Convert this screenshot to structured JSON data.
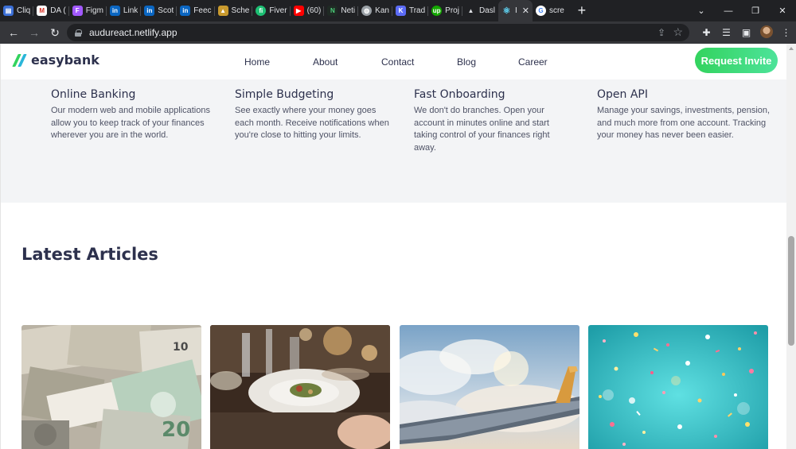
{
  "browser": {
    "tabs": [
      {
        "title": "Cliq",
        "icon": "chat-icon",
        "color": "#3b6fd6"
      },
      {
        "title": "DA (",
        "icon": "gmail-icon",
        "color": "#d93025"
      },
      {
        "title": "Figm",
        "icon": "figma-icon",
        "color": "#a259ff"
      },
      {
        "title": "Link",
        "icon": "linkedin-icon",
        "color": "#0a66c2"
      },
      {
        "title": "Scot",
        "icon": "linkedin-icon",
        "color": "#0a66c2"
      },
      {
        "title": "Feec",
        "icon": "linkedin-icon",
        "color": "#0a66c2"
      },
      {
        "title": "Sche",
        "icon": "school-icon",
        "color": "#c99a2e"
      },
      {
        "title": "Fiver",
        "icon": "fiverr-icon",
        "color": "#1dbf73"
      },
      {
        "title": "(60)",
        "icon": "youtube-icon",
        "color": "#ff0000"
      },
      {
        "title": "Neti",
        "icon": "netlify-icon",
        "color": "#1f7a3a"
      },
      {
        "title": "Kan",
        "icon": "globe-icon",
        "color": "#9aa0a6"
      },
      {
        "title": "Trad",
        "icon": "kotlin-icon",
        "color": "#5b6bf6"
      },
      {
        "title": "Proj",
        "icon": "upwork-icon",
        "color": "#14a800"
      },
      {
        "title": "Dasl",
        "icon": "vercel-icon",
        "color": "#dfe1e5"
      },
      {
        "title": "I",
        "icon": "react-icon",
        "color": "#61dafb"
      },
      {
        "title": "scre",
        "icon": "google-icon",
        "color": "#ffffff"
      }
    ],
    "url": "audureact.netlify.app"
  },
  "header": {
    "logo_text": "easybank",
    "nav": [
      "Home",
      "About",
      "Contact",
      "Blog",
      "Career"
    ],
    "cta_label": "Request Invite"
  },
  "features": [
    {
      "title": "Online Banking",
      "text": "Our modern web and mobile applications allow you to keep track of your finances wherever you are in the world."
    },
    {
      "title": "Simple Budgeting",
      "text": "See exactly where your money goes each month. Receive notifications when you're close to hitting your limits."
    },
    {
      "title": "Fast Onboarding",
      "text": "We don't do branches. Open your account in minutes online and start taking control of your finances right away."
    },
    {
      "title": "Open API",
      "text": "Manage your savings, investments, pension, and much more from one account. Tracking your money has never been easier."
    }
  ],
  "latest": {
    "title": "Latest Articles",
    "images": [
      "currency-photo",
      "restaurant-photo",
      "airplane-photo",
      "confetti-photo"
    ]
  },
  "colors": {
    "dark_blue": "#2d314d",
    "lime_green": "#33d35e",
    "bright_cyan": "#2ab6d9",
    "light_gray": "#f3f4f6"
  }
}
